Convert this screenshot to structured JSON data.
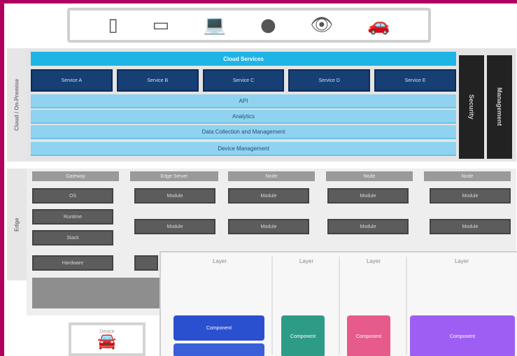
{
  "colors": {
    "frame": "#b0005f",
    "cloud_title": "#1fb4e6",
    "service_box": "#163f74",
    "band": "#8fd3f0",
    "edge_box": "#5c5c5c",
    "overlay_blue": "#2a4fcf",
    "overlay_teal": "#2e9b86",
    "overlay_pink": "#e65a8c",
    "overlay_purple": "#9f5ef3"
  },
  "devices": [
    {
      "icon": "phone-icon",
      "glyph": "▯"
    },
    {
      "icon": "tablet-icon",
      "glyph": "▭"
    },
    {
      "icon": "laptop-icon",
      "glyph": "💻"
    },
    {
      "icon": "microphone-icon",
      "glyph": "●"
    },
    {
      "icon": "eye-icon",
      "glyph": "👁"
    },
    {
      "icon": "car-icon",
      "glyph": "🚗"
    }
  ],
  "cloud": {
    "side_label": "Cloud / On-Premise",
    "title": "Cloud Services",
    "services": [
      "Service A",
      "Service B",
      "Service C",
      "Service D",
      "Service E"
    ],
    "bands": [
      "API",
      "Analytics",
      "Data Collection and Management",
      "Device Management"
    ],
    "right_cols": [
      "Security",
      "Management"
    ]
  },
  "edge": {
    "side_label": "Edge",
    "columns": [
      {
        "head": "Gateway",
        "boxes": [
          "OS",
          "Runtime",
          "Stack",
          "Hardware"
        ]
      },
      {
        "head": "Edge Server",
        "boxes": [
          "Module",
          "Module"
        ]
      },
      {
        "head": "Node",
        "boxes": [
          "Module",
          "Module"
        ]
      },
      {
        "head": "Node",
        "boxes": [
          "Module",
          "Module"
        ]
      },
      {
        "head": "Node",
        "boxes": [
          "Module",
          "Module"
        ]
      }
    ]
  },
  "bottom_device": {
    "label": "Device",
    "icon": "car-icon",
    "glyph": "🚘"
  },
  "overlay": {
    "cols": [
      {
        "head": "Layer",
        "card": "Component"
      },
      {
        "head": "Layer",
        "card": "Component"
      },
      {
        "head": "Layer",
        "card": "Component"
      },
      {
        "head": "Layer",
        "card": "Component"
      }
    ]
  }
}
